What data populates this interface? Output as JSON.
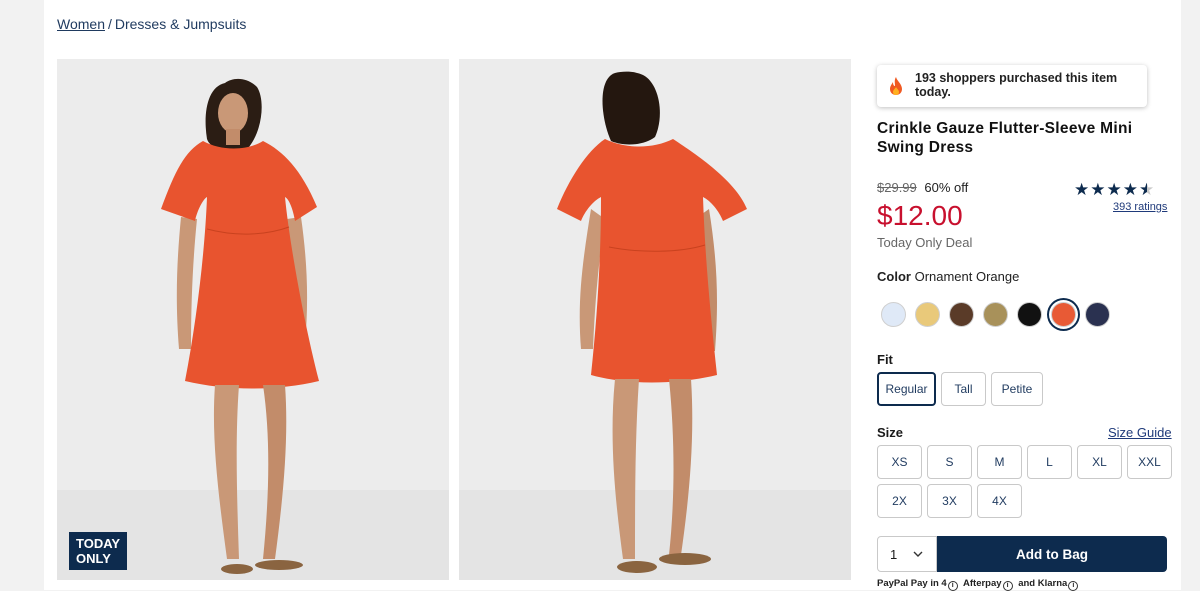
{
  "breadcrumb": {
    "women": "Women",
    "separator": "/",
    "category": "Dresses & Jumpsuits"
  },
  "badge": {
    "line1": "TODAY",
    "line2": "ONLY"
  },
  "fomo": {
    "text": "193 shoppers purchased this item today.",
    "icon": "flame-icon"
  },
  "product": {
    "title": "Crinkle Gauze Flutter-Sleeve Mini Swing Dress",
    "old_price": "$29.99",
    "discount": "60% off",
    "price": "$12.00",
    "deal": "Today Only Deal",
    "rating_stars": 4.5,
    "ratings_link": "393 ratings"
  },
  "color": {
    "label": "Color",
    "selected": "Ornament Orange",
    "swatches": [
      "#dfe9f7",
      "#e9c97a",
      "#5a3b28",
      "#a8915a",
      "#111111",
      "#e85a35",
      "#2a3150"
    ]
  },
  "fit": {
    "label": "Fit",
    "options": [
      "Regular",
      "Tall",
      "Petite"
    ],
    "selected": "Regular"
  },
  "size": {
    "label": "Size",
    "guide": "Size Guide",
    "options": [
      "XS",
      "S",
      "M",
      "L",
      "XL",
      "XXL",
      "2X",
      "3X",
      "4X"
    ]
  },
  "purchase": {
    "qty": "1",
    "add_label": "Add to Bag"
  },
  "pay": {
    "paypal": "PayPal Pay in 4",
    "afterpay": "Afterpay",
    "and": "and",
    "klarna": "Klarna"
  },
  "colors": {
    "navy": "#0d2b4e",
    "sale_red": "#c8102e",
    "dress": "#e8542f"
  }
}
